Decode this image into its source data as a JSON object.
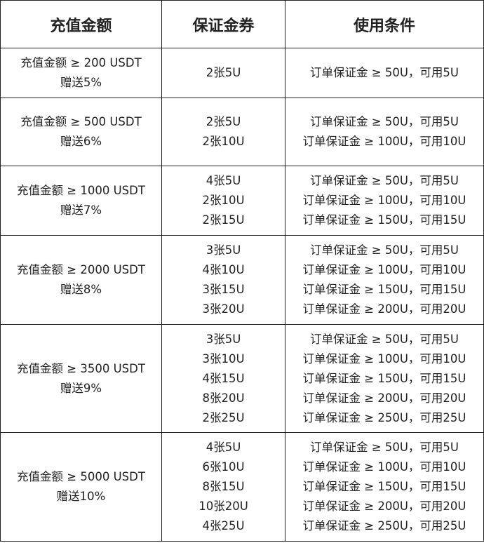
{
  "headers": [
    "充值金额",
    "保证金券",
    "使用条件"
  ],
  "rows": [
    {
      "deposit": "充值金额 ≥ 200 USDT",
      "bonus": "赠送5%",
      "coupons": [
        "2张5U"
      ],
      "conditions": [
        "订单保证金 ≥ 50U，可用5U"
      ]
    },
    {
      "deposit": "充值金额 ≥ 500 USDT",
      "bonus": "赠送6%",
      "coupons": [
        "2张5U",
        "2张10U"
      ],
      "conditions": [
        "订单保证金 ≥ 50U，可用5U",
        "订单保证金 ≥ 100U，可用10U"
      ]
    },
    {
      "deposit": "充值金额 ≥ 1000 USDT",
      "bonus": "赠送7%",
      "coupons": [
        "4张5U",
        "2张10U",
        "2张15U"
      ],
      "conditions": [
        "订单保证金 ≥ 50U，可用5U",
        "订单保证金 ≥ 100U，可用10U",
        "订单保证金 ≥ 150U，可用15U"
      ]
    },
    {
      "deposit": "充值金额 ≥ 2000 USDT",
      "bonus": "赠送8%",
      "coupons": [
        "3张5U",
        "4张10U",
        "3张15U",
        "3张20U"
      ],
      "conditions": [
        "订单保证金 ≥ 50U，可用5U",
        "订单保证金 ≥ 100U，可用10U",
        "订单保证金 ≥ 150U，可用15U",
        "订单保证金 ≥ 200U，可用20U"
      ]
    },
    {
      "deposit": "充值金额 ≥ 3500 USDT",
      "bonus": "赠送9%",
      "coupons": [
        "3张5U",
        "3张10U",
        "4张15U",
        "8张20U",
        "2张25U"
      ],
      "conditions": [
        "订单保证金 ≥ 50U，可用5U",
        "订单保证金 ≥ 100U，可用10U",
        "订单保证金 ≥ 150U，可用15U",
        "订单保证金 ≥ 200U，可用20U",
        "订单保证金 ≥ 250U，可用25U"
      ]
    },
    {
      "deposit": "充值金额 ≥ 5000 USDT",
      "bonus": "赠送10%",
      "coupons": [
        "4张5U",
        "6张10U",
        "8张15U",
        "10张20U",
        "4张25U"
      ],
      "conditions": [
        "订单保证金 ≥ 50U，可用5U",
        "订单保证金 ≥ 100U，可用10U",
        "订单保证金 ≥ 150U，可用15U",
        "订单保证金 ≥ 200U，可用20U",
        "订单保证金 ≥ 250U，可用25U"
      ]
    }
  ]
}
